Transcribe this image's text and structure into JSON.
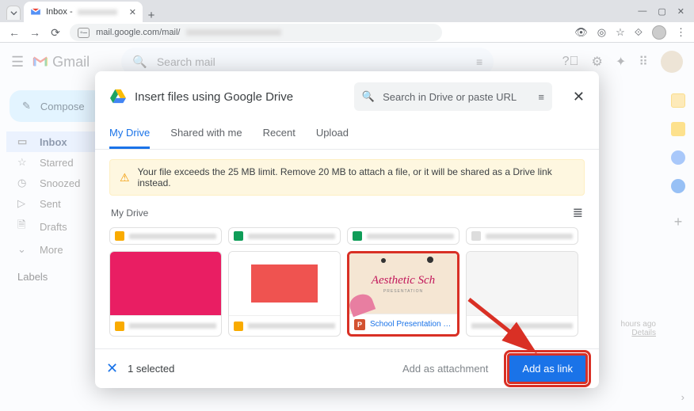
{
  "browser": {
    "tab_title": "Inbox -",
    "url_prefix": "mail.google.com/mail/"
  },
  "gmail": {
    "brand": "Gmail",
    "search_placeholder": "Search mail",
    "compose": "Compose",
    "nav": {
      "inbox": "Inbox",
      "starred": "Starred",
      "snoozed": "Snoozed",
      "sent": "Sent",
      "drafts": "Drafts",
      "more": "More"
    },
    "labels": "Labels",
    "meta": {
      "hours": "hours ago",
      "details": "Details"
    }
  },
  "dialog": {
    "title": "Insert files using Google Drive",
    "search_placeholder": "Search in Drive or paste URL",
    "tabs": {
      "mydrive": "My Drive",
      "shared": "Shared with me",
      "recent": "Recent",
      "upload": "Upload"
    },
    "warning": "Your file exceeds the 25 MB limit. Remove 20 MB to attach a file, or it will be shared as a Drive link instead.",
    "breadcrumb": "My Drive",
    "selected_file": "School Presentation …",
    "aesthetic_title": "Aesthetic Sch",
    "aesthetic_sub": "PRESENTATION",
    "footer": {
      "count": "1 selected",
      "attach": "Add as attachment",
      "link": "Add as link"
    }
  }
}
